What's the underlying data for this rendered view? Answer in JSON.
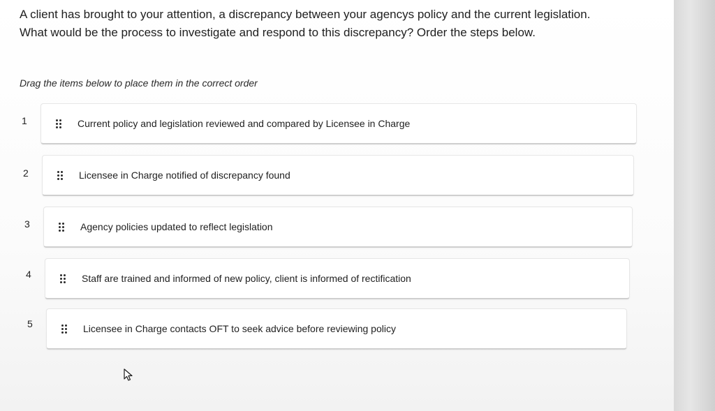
{
  "question": {
    "line1": "A client has brought to your attention, a discrepancy between your agencys policy and the current legislation.",
    "line2": "What would be the process to investigate and respond to this discrepancy? Order the steps below."
  },
  "instruction": "Drag the items below to place them in the correct order",
  "steps": [
    {
      "number": "1",
      "label": "Current policy and legislation reviewed and compared by Licensee in Charge"
    },
    {
      "number": "2",
      "label": "Licensee in Charge notified of discrepancy found"
    },
    {
      "number": "3",
      "label": "Agency policies updated to reflect legislation"
    },
    {
      "number": "4",
      "label": "Staff are trained and informed of new policy, client is informed of rectification"
    },
    {
      "number": "5",
      "label": "Licensee in Charge contacts OFT to seek advice before reviewing policy"
    }
  ],
  "icons": {
    "drag_handle": "drag-handle-icon",
    "cursor": "mouse-pointer-icon"
  },
  "colors": {
    "card_background": "#ffffff",
    "card_border": "#cfcfcf",
    "text": "#1f1f1f"
  }
}
